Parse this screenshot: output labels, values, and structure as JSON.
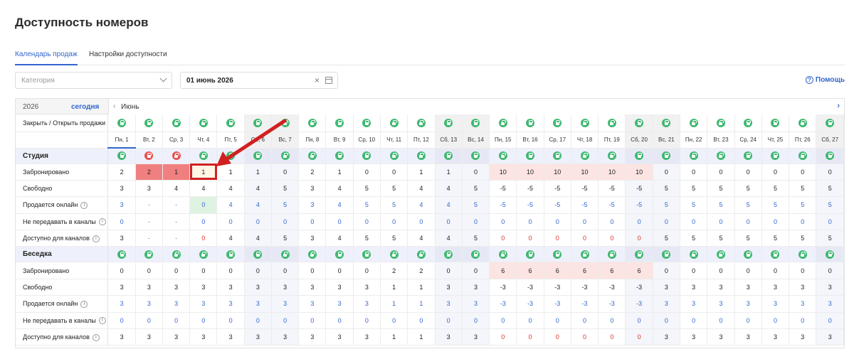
{
  "page_title": "Доступность номеров",
  "tabs": [
    {
      "label": "Календарь продаж",
      "active": true
    },
    {
      "label": "Настройки доступности",
      "active": false
    }
  ],
  "filters": {
    "category_placeholder": "Категория",
    "date_value": "01 июнь 2026"
  },
  "help_label": "Помощь",
  "grid": {
    "year": "2026",
    "today_label": "сегодня",
    "month": "Июнь",
    "close_open_label": "Закрыть / Открыть продажи",
    "days": [
      "Пн, 1",
      "Вт, 2",
      "Ср, 3",
      "Чт, 4",
      "Пт, 5",
      "Сб, 6",
      "Вс, 7",
      "Пн, 8",
      "Вт, 9",
      "Ср, 10",
      "Чт, 11",
      "Пт, 12",
      "Сб, 13",
      "Вс, 14",
      "Пн, 15",
      "Вт, 16",
      "Ср, 17",
      "Чт, 18",
      "Пт, 19",
      "Сб, 20",
      "Вс, 21",
      "Пн, 22",
      "Вт, 23",
      "Ср, 24",
      "Чт, 25",
      "Пт, 26",
      "Сб, 27"
    ],
    "weekends": [
      5,
      6,
      12,
      13,
      19,
      20,
      26
    ],
    "sections": [
      {
        "name": "Студия",
        "locks_closed": [
          1,
          2
        ],
        "rows": [
          {
            "label": "Забронировано",
            "info": false,
            "values": [
              "2",
              "2",
              "1",
              "1",
              "1",
              "1",
              "0",
              "2",
              "1",
              "0",
              "0",
              "1",
              "1",
              "0",
              "10",
              "10",
              "10",
              "10",
              "10",
              "10",
              "0",
              "0",
              "0",
              "0",
              "0",
              "0",
              "0"
            ]
          },
          {
            "label": "Свободно",
            "info": false,
            "values": [
              "3",
              "3",
              "4",
              "4",
              "4",
              "4",
              "5",
              "3",
              "4",
              "5",
              "5",
              "4",
              "4",
              "5",
              "-5",
              "-5",
              "-5",
              "-5",
              "-5",
              "-5",
              "5",
              "5",
              "5",
              "5",
              "5",
              "5",
              "5"
            ]
          },
          {
            "label": "Продается онлайн",
            "info": true,
            "values": [
              "3",
              "-",
              "-",
              "0",
              "4",
              "4",
              "5",
              "3",
              "4",
              "5",
              "5",
              "4",
              "4",
              "5",
              "-5",
              "-5",
              "-5",
              "-5",
              "-5",
              "-5",
              "5",
              "5",
              "5",
              "5",
              "5",
              "5",
              "5"
            ]
          },
          {
            "label": "Не передавать в каналы",
            "info": true,
            "values": [
              "0",
              "-",
              "-",
              "0",
              "0",
              "0",
              "0",
              "0",
              "0",
              "0",
              "0",
              "0",
              "0",
              "0",
              "0",
              "0",
              "0",
              "0",
              "0",
              "0",
              "0",
              "0",
              "0",
              "0",
              "0",
              "0",
              "0"
            ]
          },
          {
            "label": "Доступно для каналов",
            "info": true,
            "values": [
              "3",
              "-",
              "-",
              "0",
              "4",
              "4",
              "5",
              "3",
              "4",
              "5",
              "5",
              "4",
              "4",
              "5",
              "0",
              "0",
              "0",
              "0",
              "0",
              "0",
              "5",
              "5",
              "5",
              "5",
              "5",
              "5",
              "5"
            ]
          }
        ]
      },
      {
        "name": "Беседка",
        "locks_closed": [],
        "rows": [
          {
            "label": "Забронировано",
            "info": false,
            "values": [
              "0",
              "0",
              "0",
              "0",
              "0",
              "0",
              "0",
              "0",
              "0",
              "0",
              "2",
              "2",
              "0",
              "0",
              "6",
              "6",
              "6",
              "6",
              "6",
              "6",
              "0",
              "0",
              "0",
              "0",
              "0",
              "0",
              "0"
            ]
          },
          {
            "label": "Свободно",
            "info": false,
            "values": [
              "3",
              "3",
              "3",
              "3",
              "3",
              "3",
              "3",
              "3",
              "3",
              "3",
              "1",
              "1",
              "3",
              "3",
              "-3",
              "-3",
              "-3",
              "-3",
              "-3",
              "-3",
              "3",
              "3",
              "3",
              "3",
              "3",
              "3",
              "3"
            ]
          },
          {
            "label": "Продается онлайн",
            "info": true,
            "values": [
              "3",
              "3",
              "3",
              "3",
              "3",
              "3",
              "3",
              "3",
              "3",
              "3",
              "1",
              "1",
              "3",
              "3",
              "-3",
              "-3",
              "-3",
              "-3",
              "-3",
              "-3",
              "3",
              "3",
              "3",
              "3",
              "3",
              "3",
              "3"
            ]
          },
          {
            "label": "Не передавать в каналы",
            "info": true,
            "values": [
              "0",
              "0",
              "0",
              "0",
              "0",
              "0",
              "0",
              "0",
              "0",
              "0",
              "0",
              "0",
              "0",
              "0",
              "0",
              "0",
              "0",
              "0",
              "0",
              "0",
              "0",
              "0",
              "0",
              "0",
              "0",
              "0",
              "0"
            ]
          },
          {
            "label": "Доступно для каналов",
            "info": true,
            "values": [
              "3",
              "3",
              "3",
              "3",
              "3",
              "3",
              "3",
              "3",
              "3",
              "3",
              "1",
              "1",
              "3",
              "3",
              "0",
              "0",
              "0",
              "0",
              "0",
              "0",
              "3",
              "3",
              "3",
              "3",
              "3",
              "3",
              "3"
            ]
          }
        ]
      }
    ]
  },
  "colors": {
    "accent": "#3366cc",
    "lock_open": "#3fb871",
    "lock_closed": "#e84f4f",
    "annotation_red": "#d22020"
  }
}
